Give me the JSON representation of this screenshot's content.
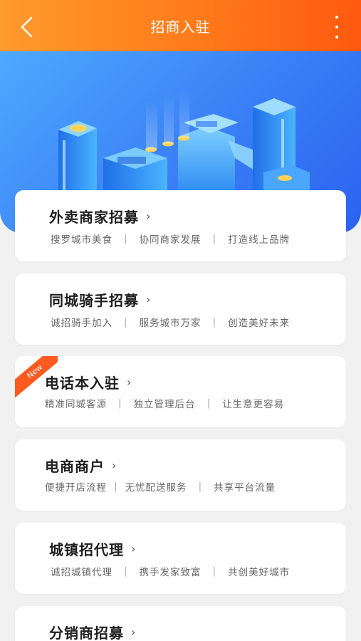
{
  "header": {
    "title": "招商入驻",
    "back_icon": "chevron-left-icon",
    "more_icon": "more-vertical-icon"
  },
  "cards": [
    {
      "title": "外卖商家招募",
      "tags": [
        "搜罗城市美食",
        "协同商家发展",
        "打造线上品牌"
      ],
      "badge": ""
    },
    {
      "title": "同城骑手招募",
      "tags": [
        "诚招骑手加入",
        "服务城市万家",
        "创造美好未来"
      ],
      "badge": ""
    },
    {
      "title": "电话本入驻",
      "tags": [
        "精准同城客源",
        "独立管理后台",
        "让生意更容易"
      ],
      "badge": "New"
    },
    {
      "title": "电商商户",
      "tags": [
        "便捷开店流程",
        "无忧配送服务",
        "共享平台流量"
      ],
      "badge": ""
    },
    {
      "title": "城镇招代理",
      "tags": [
        "诚招城镇代理",
        "携手发家致富",
        "共创美好城市"
      ],
      "badge": ""
    },
    {
      "title": "分销商招募",
      "tags": [],
      "badge": ""
    }
  ],
  "colors": {
    "header_start": "#ff9a2e",
    "header_end": "#ff5a0f",
    "banner": "#3b83f6",
    "new_badge": "#ff5a1f"
  }
}
